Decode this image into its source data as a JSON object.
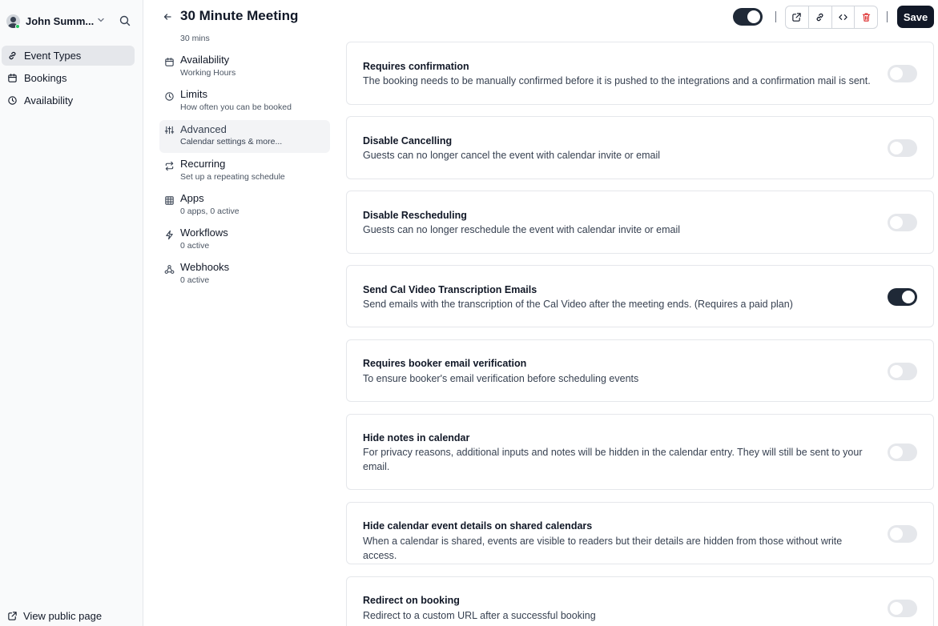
{
  "user": {
    "name": "John Summ..."
  },
  "nav": [
    {
      "label": "Event Types",
      "icon": "link-icon",
      "active": true
    },
    {
      "label": "Bookings",
      "icon": "calendar-icon",
      "active": false
    },
    {
      "label": "Availability",
      "icon": "clock-icon",
      "active": false
    }
  ],
  "footer": {
    "public_page": "View public page"
  },
  "header": {
    "title": "30 Minute Meeting",
    "save_label": "Save",
    "hidden_toggle": "on"
  },
  "subnav": {
    "duration": "30 mins",
    "items": [
      {
        "title": "Availability",
        "desc": "Working Hours",
        "icon": "calendar-icon"
      },
      {
        "title": "Limits",
        "desc": "How often you can be booked",
        "icon": "clock-icon"
      },
      {
        "title": "Advanced",
        "desc": "Calendar settings & more...",
        "icon": "sliders-icon",
        "active": true
      },
      {
        "title": "Recurring",
        "desc": "Set up a repeating schedule",
        "icon": "repeat-icon"
      },
      {
        "title": "Apps",
        "desc": "0 apps, 0 active",
        "icon": "grid-icon"
      },
      {
        "title": "Workflows",
        "desc": "0 active",
        "icon": "zap-icon"
      },
      {
        "title": "Webhooks",
        "desc": "0 active",
        "icon": "webhook-icon"
      }
    ]
  },
  "settings": [
    {
      "title": "Requires confirmation",
      "desc": "The booking needs to be manually confirmed before it is pushed to the integrations and a confirmation mail is sent.",
      "enabled": false
    },
    {
      "title": "Disable Cancelling",
      "desc": "Guests can no longer cancel the event with calendar invite or email",
      "enabled": false
    },
    {
      "title": "Disable Rescheduling",
      "desc": "Guests can no longer reschedule the event with calendar invite or email",
      "enabled": false
    },
    {
      "title": "Send Cal Video Transcription Emails",
      "desc": "Send emails with the transcription of the Cal Video after the meeting ends. (Requires a paid plan)",
      "enabled": true
    },
    {
      "title": "Requires booker email verification",
      "desc": "To ensure booker's email verification before scheduling events",
      "enabled": false
    },
    {
      "title": "Hide notes in calendar",
      "desc": "For privacy reasons, additional inputs and notes will be hidden in the calendar entry. They will still be sent to your email.",
      "enabled": false
    },
    {
      "title": "Hide calendar event details on shared calendars",
      "desc": "When a calendar is shared, events are visible to readers but their details are hidden from those without write access.",
      "enabled": false
    },
    {
      "title": "Redirect on booking",
      "desc": "Redirect to a custom URL after a successful booking",
      "enabled": false
    }
  ]
}
